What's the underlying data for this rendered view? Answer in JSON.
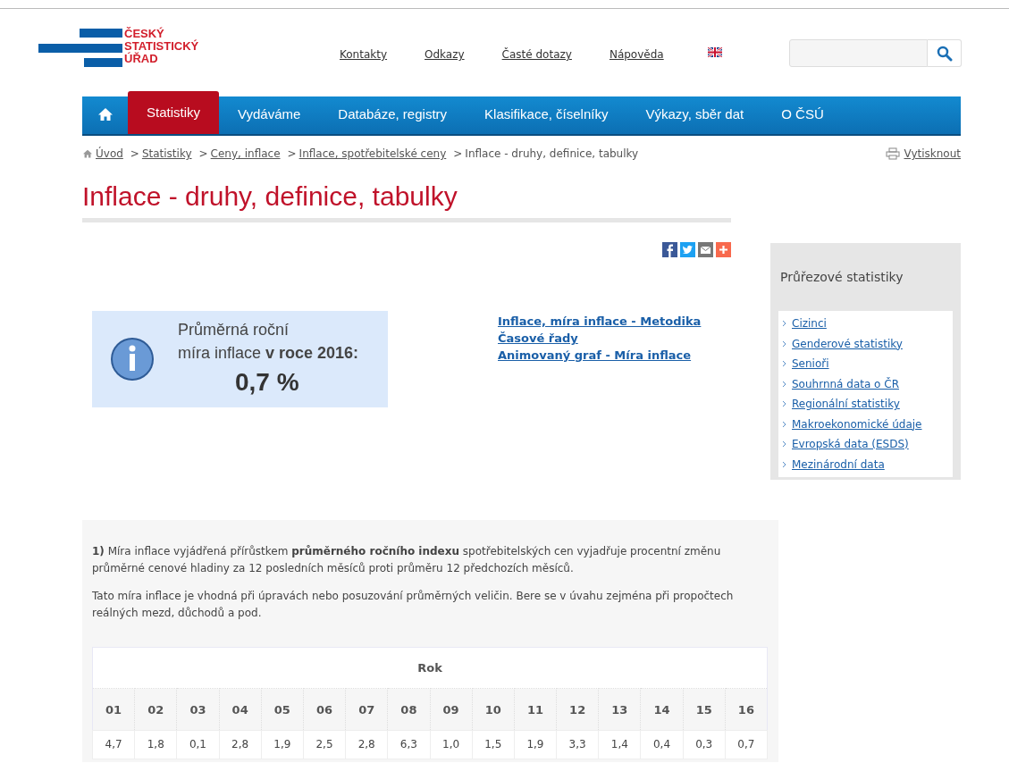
{
  "logo": {
    "lines": [
      "ČESKÝ",
      "STATISTICKÝ",
      "ÚŘAD"
    ]
  },
  "top_links": [
    "Kontakty",
    "Odkazy",
    "Časté dotazy",
    "Nápověda"
  ],
  "nav": [
    {
      "kind": "home",
      "selected": false
    },
    {
      "kind": "text",
      "label": "Statistiky",
      "selected": true
    },
    {
      "kind": "text",
      "label": "Vydáváme",
      "selected": false
    },
    {
      "kind": "text",
      "label": "Databáze, registry",
      "selected": false
    },
    {
      "kind": "text",
      "label": "Klasifikace, číselníky",
      "selected": false
    },
    {
      "kind": "text",
      "label": "Výkazy, sběr dat",
      "selected": false
    },
    {
      "kind": "text",
      "label": "O ČSÚ",
      "selected": false
    }
  ],
  "breadcrumb": {
    "links": [
      {
        "text": "Úvod"
      },
      {
        "separator": ">",
        "text": "Statistiky"
      },
      {
        "separator": ">",
        "text": "Ceny, inflace"
      },
      {
        "separator": ">",
        "text": "Inflace, spotřebitelské ceny"
      }
    ],
    "current": {
      "separator": ">",
      "text": "Inflace - druhy, definice, tabulky"
    }
  },
  "print_link": "Vytisknout",
  "page_title": "Inflace - druhy, definice, tabulky",
  "info_box": {
    "line1": "Průměrná roční",
    "line2": "míra inflace **v roce 2016:**",
    "value": "0,7 %"
  },
  "related_links": [
    "Inflace, míra inflace - Metodika",
    "Časové řady",
    "Animovaný graf - Míra inflace"
  ],
  "sidebar": {
    "title": "Průřezové statistiky",
    "items": [
      "Cizinci",
      "Genderové statistiky",
      "Senioři",
      "Souhrnná data o ČR",
      "Regionální statistiky",
      "Makroekonomické údaje",
      "Evropská data (ESDS)",
      "Mezinárodní data"
    ]
  },
  "section": {
    "paragraphs": [
      "**1)** Míra inflace vyjádřená přírůstkem **průměrného ročního indexu** spotřebitelských cen vyjadřuje procentní změnu průměrné cenové hladiny za 12 posledních měsíců proti průměru 12 předchozích měsíců.",
      "Tato míra inflace je vhodná při úpravách nebo posuzování průměrných veličin. Bere se v úvahu zejména při propočtech reálných mezd, důchodů a pod."
    ],
    "table": {
      "caption": "Rok",
      "columns": [
        "01",
        "02",
        "03",
        "04",
        "05",
        "06",
        "07",
        "08",
        "09",
        "10",
        "11",
        "12",
        "13",
        "14",
        "15",
        "16"
      ],
      "rows": [
        [
          "4,7",
          "1,8",
          "0,1",
          "2,8",
          "1,9",
          "2,5",
          "2,8",
          "6,3",
          "1,0",
          "1,5",
          "1,9",
          "3,3",
          "1,4",
          "0,4",
          "0,3",
          "0,7"
        ]
      ]
    }
  }
}
